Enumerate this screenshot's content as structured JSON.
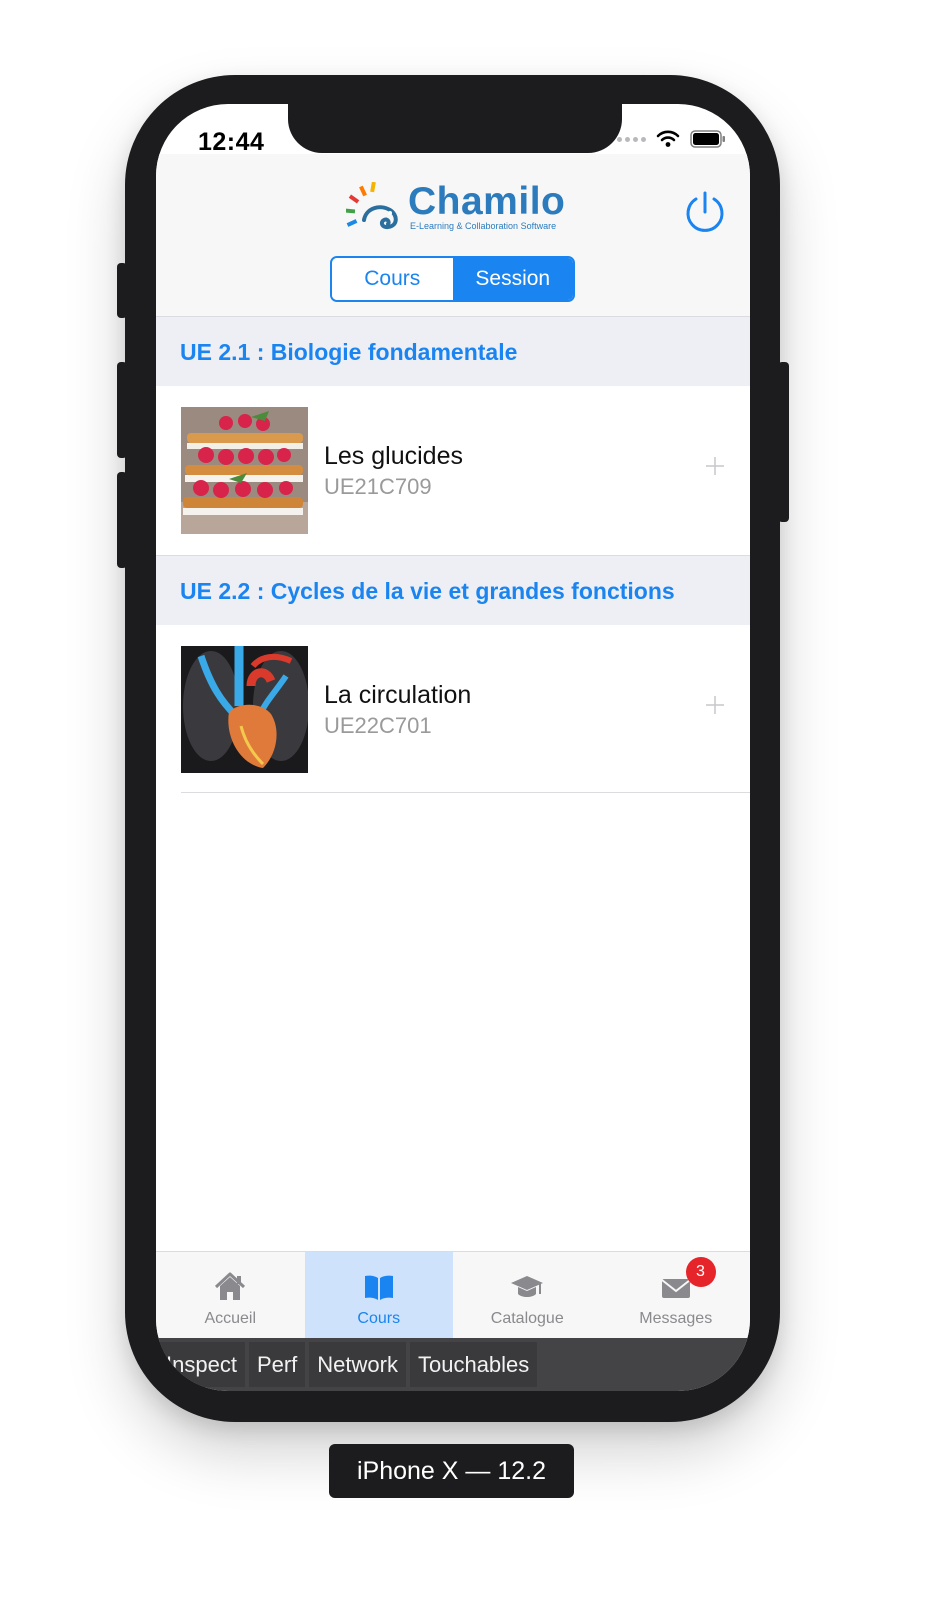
{
  "status": {
    "time": "12:44"
  },
  "brand": {
    "name": "Chamilo",
    "tagline": "E-Learning & Collaboration Software"
  },
  "segments": [
    {
      "label": "Cours"
    },
    {
      "label": "Session"
    }
  ],
  "sections": [
    {
      "title": "UE 2.1 : Biologie fondamentale",
      "course": {
        "name": "Les glucides",
        "code": "UE21C709"
      }
    },
    {
      "title": "UE 2.2 : Cycles de la vie et grandes fonctions",
      "course": {
        "name": "La circulation",
        "code": "UE22C701"
      }
    }
  ],
  "tabs": [
    {
      "label": "Accueil",
      "icon": "home-icon"
    },
    {
      "label": "Cours",
      "icon": "book-icon"
    },
    {
      "label": "Catalogue",
      "icon": "graduation-cap-icon"
    },
    {
      "label": "Messages",
      "icon": "envelope-icon",
      "badge": "3"
    }
  ],
  "devtools": [
    "Inspect",
    "Perf",
    "Network",
    "Touchables"
  ],
  "device": {
    "label": "iPhone X — 12.2"
  },
  "colors": {
    "accent": "#1a84f0",
    "header_bg": "#eeeff4",
    "badge": "#e5252a"
  }
}
